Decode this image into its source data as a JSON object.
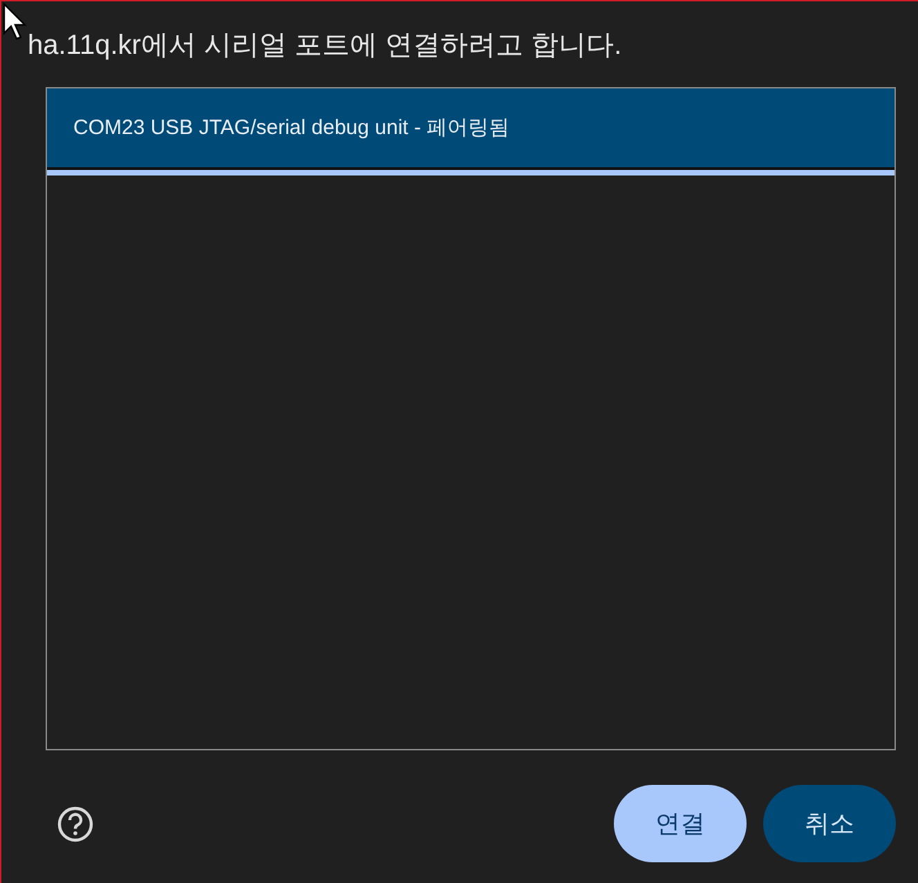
{
  "dialog": {
    "title": "ha.11q.kr에서 시리얼 포트에 연결하려고 합니다."
  },
  "ports": [
    {
      "label": "COM23 USB JTAG/serial debug unit - 페어링됨",
      "selected": true
    }
  ],
  "buttons": [
    {
      "label": "연결",
      "kind": "primary"
    },
    {
      "label": "취소",
      "kind": "secondary"
    }
  ]
}
